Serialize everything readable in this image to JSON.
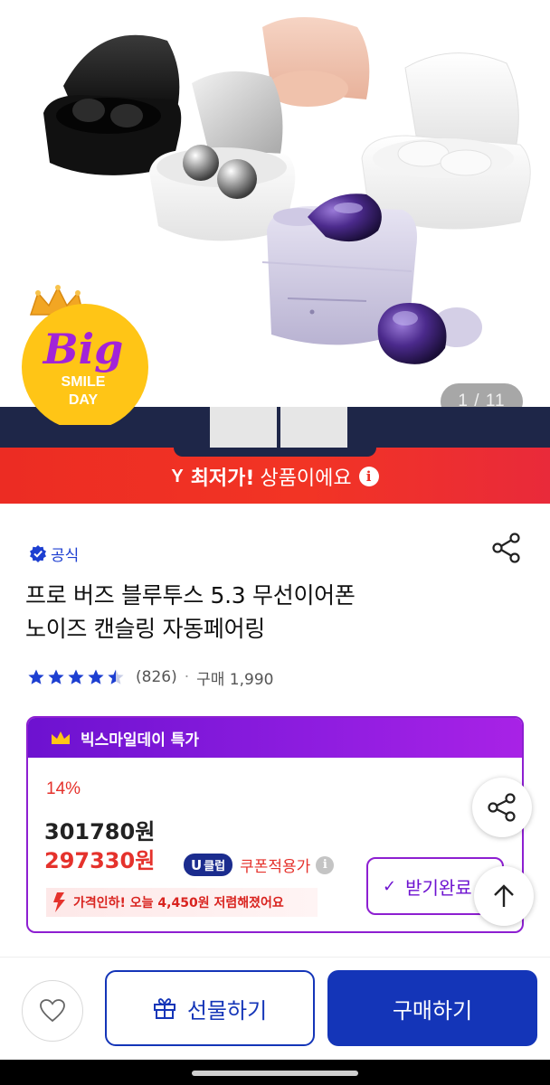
{
  "gallery": {
    "page_indicator": "1 / 11"
  },
  "promo_banner": {
    "logo_text": "Big",
    "logo_sub1": "SMILE",
    "logo_sub2": "DAY",
    "brand_mark": "Y",
    "lowest_bold": "최저가!",
    "lowest_rest": "상품이에요",
    "info_glyph": "i"
  },
  "product": {
    "seller_label": "공식",
    "title_line1": "프로 버즈 블루투스 5.3 무선이어폰",
    "title_line2": "노이즈 캔슬링 자동페어링",
    "rating_stars": 4.5,
    "review_count": "(826)",
    "purchase_count": "구매 1,990"
  },
  "promo_box": {
    "header": "빅스마일데이 특가",
    "discount": "14%",
    "original_price": "301780원",
    "sale_price": "297330원",
    "club_badge": "클럽",
    "club_letter": "U",
    "coupon_label": "쿠폰적용가",
    "price_drop_text": "가격인하! 오늘 4,450원 저렴해졌어요",
    "coupon_button": "받기완료",
    "coupon_check": "✓"
  },
  "bottom_bar": {
    "gift_label": "선물하기",
    "buy_label": "구매하기"
  },
  "colors": {
    "brand_blue": "#1435b8",
    "promo_purple": "#8d1fd1",
    "sale_red": "#e5322c",
    "banner_red": "#ec2c23",
    "navy": "#1e2648"
  }
}
